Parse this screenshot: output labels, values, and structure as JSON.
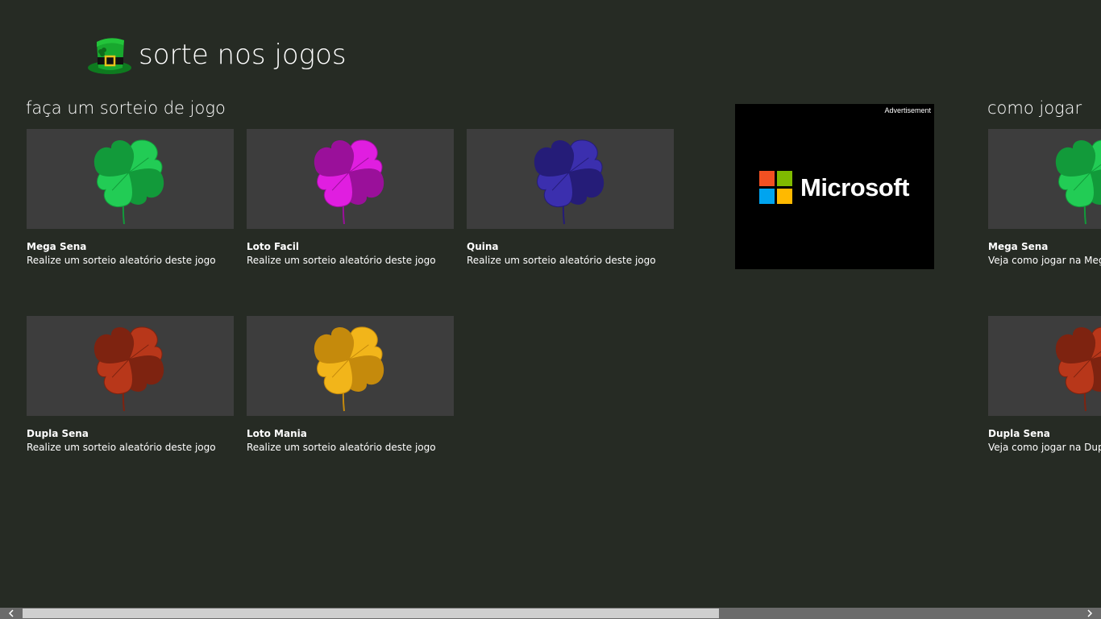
{
  "app": {
    "title": "sorte nos jogos",
    "logo_icon": "leprechaun-hat-icon"
  },
  "draw_section": {
    "heading": "faça um sorteio de jogo",
    "tiles": [
      {
        "title": "Mega Sena",
        "subtitle": "Realize um sorteio aleatório deste jogo",
        "icon": "clover-icon",
        "color": "#22cc55",
        "dark": "#129a3a"
      },
      {
        "title": "Loto Facil",
        "subtitle": "Realize um sorteio aleatório deste jogo",
        "icon": "clover-icon",
        "color": "#e01ee0",
        "dark": "#9a109a"
      },
      {
        "title": "Quina",
        "subtitle": "Realize um sorteio aleatório deste jogo",
        "icon": "clover-icon",
        "color": "#3b2fae",
        "dark": "#251c78"
      },
      {
        "title": "Dupla Sena",
        "subtitle": "Realize um sorteio aleatório deste jogo",
        "icon": "clover-icon",
        "color": "#b8371a",
        "dark": "#7e2310"
      },
      {
        "title": "Loto Mania",
        "subtitle": "Realize um sorteio aleatório deste jogo",
        "icon": "clover-icon",
        "color": "#f2b51a",
        "dark": "#c58a0c"
      }
    ]
  },
  "advertisement": {
    "label": "Advertisement",
    "brand": "Microsoft",
    "logo_colors": [
      "#f25022",
      "#7fba00",
      "#00a4ef",
      "#ffb900"
    ]
  },
  "howto_section": {
    "heading": "como jogar",
    "tiles": [
      {
        "title": "Mega Sena",
        "subtitle": "Veja como jogar na Mega Sena",
        "icon": "clover-icon",
        "color": "#22cc55",
        "dark": "#129a3a"
      },
      {
        "title": "Dupla Sena",
        "subtitle": "Veja como jogar na Dupla Sena",
        "icon": "clover-icon",
        "color": "#b8371a",
        "dark": "#7e2310"
      }
    ]
  },
  "scrollbar": {
    "left_icon": "chevron-left-icon",
    "right_icon": "chevron-right-icon",
    "position_fraction": 0.0,
    "visible_fraction": 0.66
  }
}
